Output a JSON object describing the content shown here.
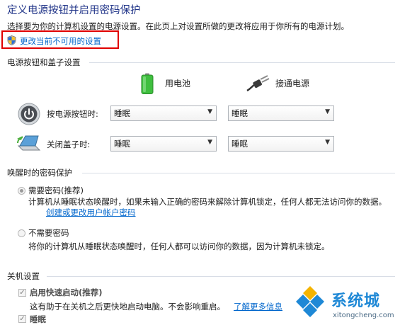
{
  "header": {
    "title": "定义电源按钮并启用密码保护",
    "description": "选择要为你的计算机设置的电源设置。在此页上对设置所做的更改将应用于你所有的电源计划。",
    "change_link": "更改当前不可用的设置"
  },
  "power_buttons": {
    "section_title": "电源按钮和盖子设置",
    "battery_label": "用电池",
    "plugged_label": "接通电源",
    "rows": [
      {
        "label": "按电源按钮时:",
        "battery_value": "睡眠",
        "plugged_value": "睡眠",
        "icon": "power-button-icon"
      },
      {
        "label": "关闭盖子时:",
        "battery_value": "睡眠",
        "plugged_value": "睡眠",
        "icon": "laptop-lid-icon"
      }
    ]
  },
  "password": {
    "section_title": "唤醒时的密码保护",
    "require_label": "需要密码(推荐)",
    "require_desc": "计算机从睡眠状态唤醒时，如果未输入正确的密码来解除计算机锁定，任何人都无法访问你的数据。",
    "require_link": "创建或更改用户帐户密码",
    "no_require_label": "不需要密码",
    "no_require_desc": "将你的计算机从睡眠状态唤醒时，任何人都可以访问你的数据，因为计算机未锁定。",
    "selected": "require"
  },
  "shutdown": {
    "section_title": "关机设置",
    "fast_startup_label": "启用快速启动(推荐)",
    "fast_startup_desc": "这有助于在关机之后更快地启动电脑。不会影响重启。",
    "learn_more": "了解更多信息",
    "sleep_label": "睡眠",
    "fast_startup_checked": true,
    "sleep_checked": true
  },
  "watermark": {
    "text": "系统城",
    "url": "xitongcheng.com"
  },
  "colors": {
    "title": "#1e3287",
    "link": "#0066cc",
    "highlight_box": "#e00000",
    "section_line": "#d8dde6"
  }
}
